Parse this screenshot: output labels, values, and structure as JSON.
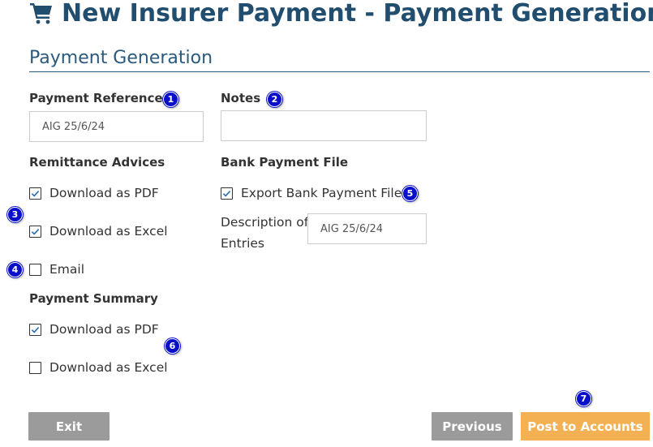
{
  "page": {
    "title": "New Insurer Payment - Payment Generation",
    "title_icon": "shopping-cart-icon",
    "section_title": "Payment Generation",
    "colors": {
      "title": "#214d6e",
      "button_gray": "#9b9b9b",
      "button_orange": "#f4b153",
      "badge": "#0a10c9"
    }
  },
  "form": {
    "payment_reference": {
      "label": "Payment Reference",
      "value": "AIG 25/6/24",
      "badge": "1"
    },
    "notes": {
      "label": "Notes",
      "value": "",
      "badge": "2"
    },
    "remittance_advices": {
      "label": "Remittance Advices",
      "badge_options": "3",
      "badge_email": "4",
      "options": [
        {
          "label": "Download as PDF",
          "checked": true
        },
        {
          "label": "Download as Excel",
          "checked": true
        },
        {
          "label": "Email",
          "checked": false
        }
      ]
    },
    "bank_payment_file": {
      "label": "Bank Payment File",
      "badge": "5",
      "export_label": "Export Bank Payment File",
      "export_checked": true,
      "description_label": "Description of Entries",
      "description_value": "AIG 25/6/24"
    },
    "payment_summary": {
      "label": "Payment Summary",
      "badge": "6",
      "options": [
        {
          "label": "Download as PDF",
          "checked": true
        },
        {
          "label": "Download as Excel",
          "checked": false
        }
      ]
    }
  },
  "buttons": {
    "exit": "Exit",
    "previous": "Previous",
    "post": "Post to Accounts",
    "post_badge": "7"
  }
}
